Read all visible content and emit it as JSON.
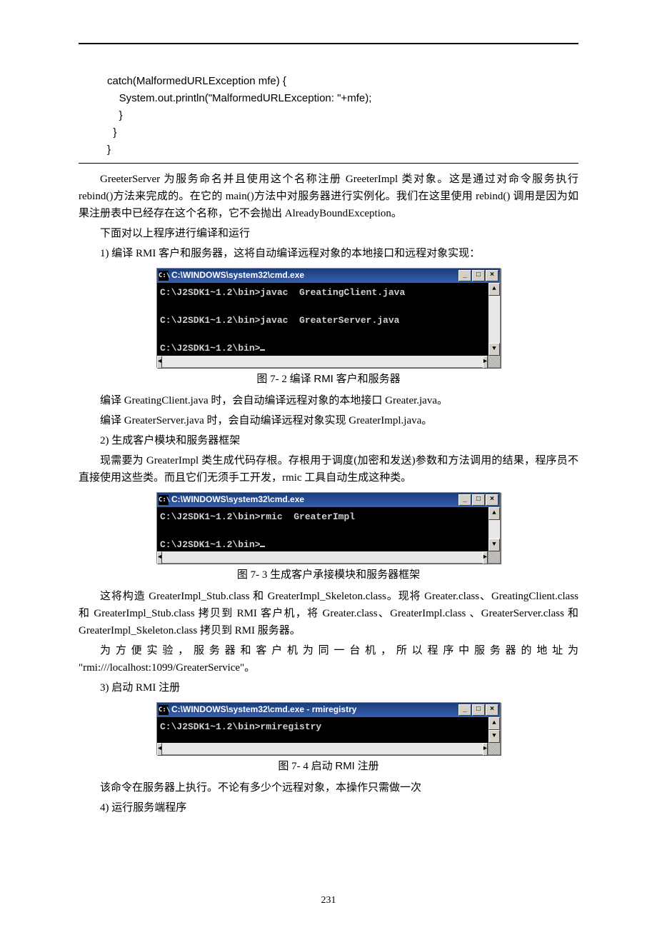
{
  "code": {
    "line1": "catch(MalformedURLException mfe) {",
    "line2": "    System.out.println(\"MalformedURLException: \"+mfe);",
    "line3": "}",
    "line4": "  }",
    "line5": "}"
  },
  "body": {
    "p1": "GreeterServer 为服务命名并且使用这个名称注册 GreeterImpl 类对象。这是通过对命令服务执行 rebind()方法来完成的。在它的 main()方法中对服务器进行实例化。我们在这里使用 rebind() 调用是因为如果注册表中已经存在这个名称，它不会抛出 AlreadyBoundException。",
    "p2": "下面对以上程序进行编译和运行",
    "p3": "1)  编译 RMI 客户和服务器，这将自动编译远程对象的本地接口和远程对象实现：",
    "caption1_a": "图 7- 2  编译 ",
    "caption1_b": "RMI",
    "caption1_c": " 客户和服务器",
    "p4": "编译 GreatingClient.java 时，会自动编译远程对象的本地接口 Greater.java。",
    "p5": "编译 GreaterServer.java 时，会自动编译远程对象实现 GreaterImpl.java。",
    "p6": "2)  生成客户模块和服务器框架",
    "p7": "现需要为 GreaterImpl 类生成代码存根。存根用于调度(加密和发送)参数和方法调用的结果，程序员不直接使用这些类。而且它们无须手工开发，rmic 工具自动生成这种类。",
    "caption2": "图 7- 3 生成客户承接模块和服务器框架",
    "p8": "这将构造 GreaterImpl_Stub.class 和 GreaterImpl_Skeleton.class。现将 Greater.class、GreatingClient.class 和 GreaterImpl_Stub.class 拷贝到 RMI 客户机，将 Greater.class、GreaterImpl.class 、GreaterServer.class 和 GreaterImpl_Skeleton.class 拷贝到 RMI 服务器。",
    "p9": "为方便实验，服务器和客户机为同一台机，所以程序中服务器的地址为 \"rmi:///localhost:1099/GreaterService\"。",
    "p10": "3)  启动 RMI 注册",
    "caption3_a": "图 7- 4  启动 ",
    "caption3_b": "RMI",
    "caption3_c": " 注册",
    "p11": "该命令在服务器上执行。不论有多少个远程对象，本操作只需做一次",
    "p12": "4)  运行服务端程序"
  },
  "cmd": {
    "win_min": "_",
    "win_max": "□",
    "win_close": "×",
    "up": "▲",
    "down": "▼",
    "left": "◄",
    "right": "►"
  },
  "fig1": {
    "title": "C:\\WINDOWS\\system32\\cmd.exe",
    "l1": "C:\\J2SDK1~1.2\\bin>javac  GreatingClient.java",
    "l2": "C:\\J2SDK1~1.2\\bin>javac  GreaterServer.java",
    "l3": "C:\\J2SDK1~1.2\\bin>"
  },
  "fig2": {
    "title": "C:\\WINDOWS\\system32\\cmd.exe",
    "l1": "C:\\J2SDK1~1.2\\bin>rmic  GreaterImpl",
    "l2": "C:\\J2SDK1~1.2\\bin>"
  },
  "fig3": {
    "title": "C:\\WINDOWS\\system32\\cmd.exe - rmiregistry",
    "l1": "C:\\J2SDK1~1.2\\bin>rmiregistry"
  },
  "page_number": "231"
}
